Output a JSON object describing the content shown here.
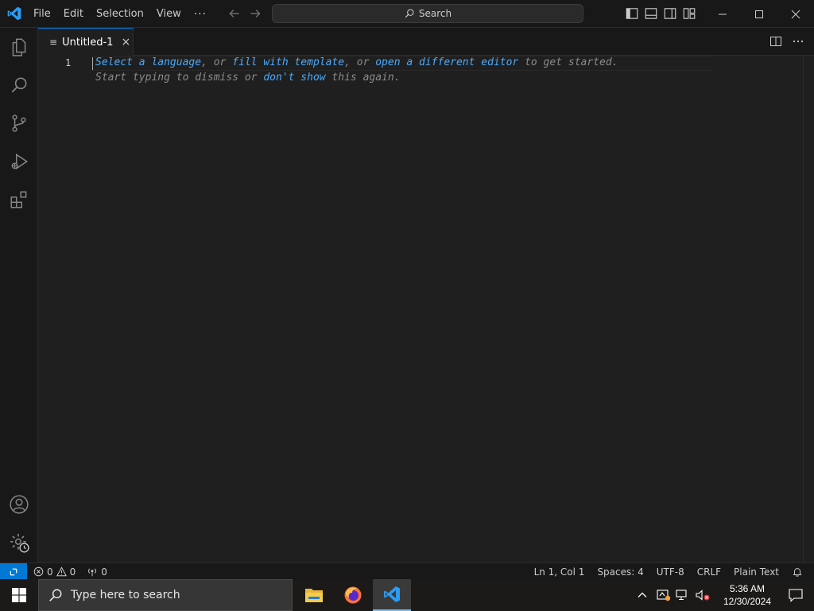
{
  "titlebar": {
    "menu": [
      "File",
      "Edit",
      "Selection",
      "View"
    ],
    "more": "···",
    "search_label": "Search"
  },
  "tabs": [
    {
      "label": "Untitled-1",
      "close": "×"
    }
  ],
  "editor": {
    "line_number": "1",
    "hint_line1": [
      {
        "text": "Select a language",
        "link": true
      },
      {
        "text": ", or ",
        "link": false
      },
      {
        "text": "fill with template",
        "link": true
      },
      {
        "text": ", or ",
        "link": false
      },
      {
        "text": "open a different editor",
        "link": true
      },
      {
        "text": " to get started.",
        "link": false
      }
    ],
    "hint_line2": [
      {
        "text": "Start typing to dismiss or ",
        "link": false
      },
      {
        "text": "don't show",
        "link": true
      },
      {
        "text": " this again.",
        "link": false
      }
    ]
  },
  "statusbar": {
    "errors": "0",
    "warnings": "0",
    "ports": "0",
    "position": "Ln 1, Col 1",
    "spaces": "Spaces: 4",
    "encoding": "UTF-8",
    "eol": "CRLF",
    "language": "Plain Text"
  },
  "taskbar": {
    "search_placeholder": "Type here to search",
    "time": "5:36 AM",
    "date": "12/30/2024"
  },
  "colors": {
    "accent": "#0078d4",
    "link": "#4daafc",
    "background": "#1f1f1f"
  }
}
